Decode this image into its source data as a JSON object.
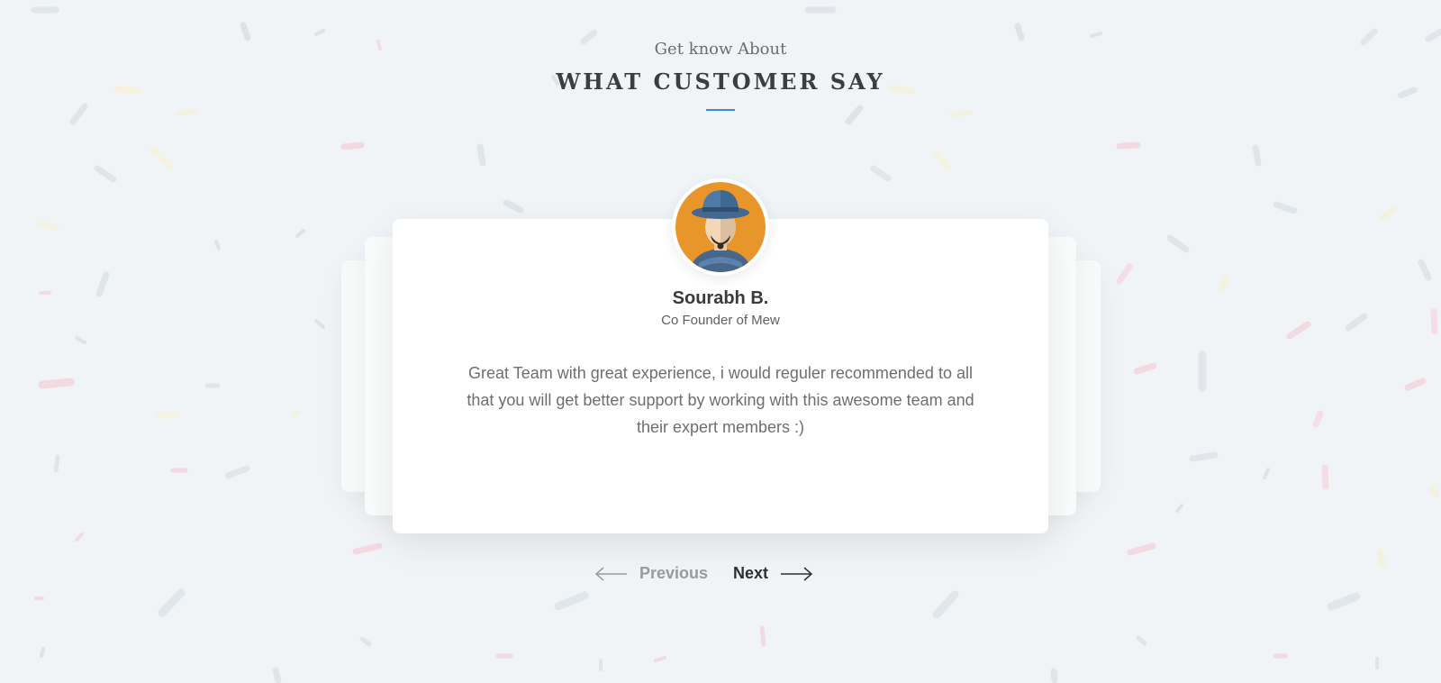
{
  "header": {
    "eyebrow": "Get know About",
    "title": "WHAT CUSTOMER SAY"
  },
  "testimonial": {
    "name": "Sourabh B.",
    "role": "Co Founder of Mew",
    "quote": "Great Team with great experience, i would reguler recommended to all that you will get better support by working with this awesome team and their expert members :)"
  },
  "navigation": {
    "previous_label": "Previous",
    "next_label": "Next"
  },
  "colors": {
    "background": "#f0f4f7",
    "accent": "#2f8fd8",
    "heading": "#3d3d3d",
    "text": "#6e6e6e",
    "avatar_bg": "#e8962a",
    "hat": "#4b6f95"
  },
  "icons": {
    "previous": "arrow-left-icon",
    "next": "arrow-right-icon"
  }
}
